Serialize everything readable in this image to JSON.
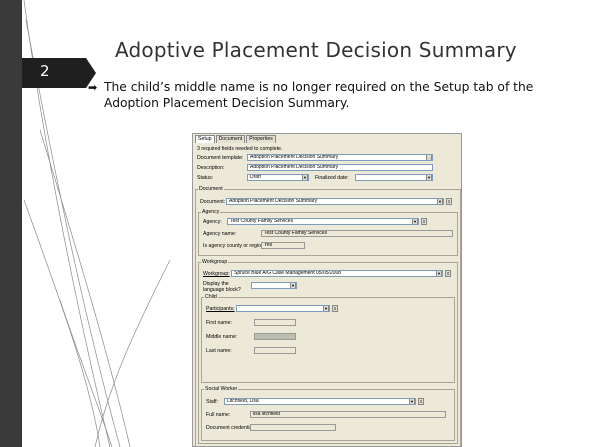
{
  "slide": {
    "number": "2",
    "title": "Adoptive Placement Decision Summary",
    "bullet_text": "The child’s middle name is no longer required on the Setup tab of the Adoption Placement Decision Summary."
  },
  "colors": {
    "number_tag": "#1f1f1f",
    "left_bar": "#3a3a3a",
    "title_text": "#333333"
  },
  "shot": {
    "tabs": [
      "Setup",
      "Document",
      "Properties"
    ],
    "required_note": "3 required fields needed to complete.",
    "document_template_label": "Document template:",
    "document_template_value": "Adoption Placement Decision Summary",
    "description_label": "Description:",
    "description_value": "Adoption Placement Decision Summary",
    "status_label": "Status:",
    "status_value": "Draft",
    "finalized_date_label": "Finalized date:",
    "document_group": "Document",
    "document_label": "Document:",
    "document_value": "Adoption Placement Decision Summary",
    "agency_group": "Agency",
    "agency_label": "Agency:",
    "agency_value": "Test County Family Services",
    "agency_name_label": "Agency name:",
    "agency_name_value": "Test County Family Services",
    "agency_county_label": "Is agency county or region:",
    "agency_county_value": "Yes",
    "workgroup_group": "Workgroup",
    "workgroup_label": "Workgroup:",
    "workgroup_value": "Spruce Blue A/G Case Management 05/05/2008",
    "display_language_label": "Display the language block?",
    "child_group": "Child",
    "participants_label": "Participants:",
    "first_name_label": "First name:",
    "middle_name_label": "Middle name:",
    "last_name_label": "Last name:",
    "social_worker_group": "Social Worker",
    "staff_label": "Staff:",
    "staff_value": "Litchfield, Lisa",
    "full_name_label": "Full name:",
    "full_name_value": "lisa litchfield",
    "credentials_label": "Document credentials:"
  }
}
